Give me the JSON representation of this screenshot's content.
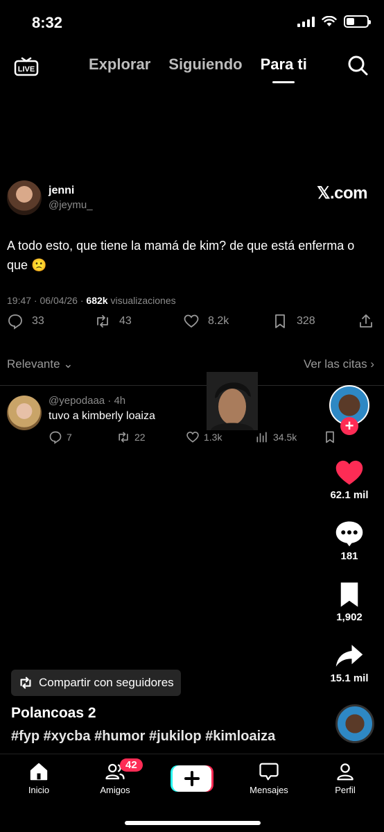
{
  "status_bar": {
    "time": "8:32"
  },
  "top_nav": {
    "live_label": "LIVE",
    "tabs": [
      {
        "label": "Explorar"
      },
      {
        "label": "Siguiendo"
      },
      {
        "label": "Para ti"
      }
    ]
  },
  "tweet": {
    "name": "jenni",
    "handle": "@jeymu_",
    "source": "𝕏.com",
    "text": "A todo esto, que tiene la mamá de kim? de que está enferma o que 🙁",
    "time_date": "19:47 · 06/04/26 · ",
    "views_count": "682k",
    "views_label": " visualizaciones",
    "replies": "33",
    "retweets": "43",
    "likes": "8.2k",
    "bookmarks": "328",
    "sort_label": "Relevante",
    "quotes_label": "Ver las citas"
  },
  "reply": {
    "handle_time": "@yepodaaa · 4h",
    "text": "tuvo a kimberly loaiza",
    "replies": "7",
    "retweets": "22",
    "likes": "1.3k",
    "views": "34.5k"
  },
  "right_rail": {
    "likes": "62.1 mil",
    "comments": "181",
    "saves": "1,902",
    "shares": "15.1 mil",
    "follow_label": "+"
  },
  "video": {
    "share_label": "Compartir con seguidores",
    "title": "Polancoas 2",
    "hashtags": "#fyp #xycba #humor #jukilop #kimloaiza"
  },
  "bottom_nav": {
    "home": "Inicio",
    "friends": "Amigos",
    "friends_badge": "42",
    "inbox": "Mensajes",
    "profile": "Perfil"
  },
  "colors": {
    "accent": "#fe2c55",
    "background": "#000000",
    "muted": "#8b8b8b"
  }
}
